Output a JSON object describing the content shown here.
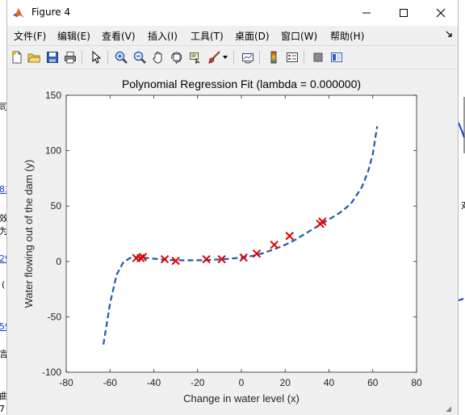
{
  "window": {
    "title": "Figure 4",
    "controls": {
      "minimize": "─",
      "maximize": "☐",
      "close": "✕"
    }
  },
  "menu": [
    {
      "label": "文件(F)"
    },
    {
      "label": "编辑(E)"
    },
    {
      "label": "查看(V)"
    },
    {
      "label": "插入(I)"
    },
    {
      "label": "工具(T)"
    },
    {
      "label": "桌面(D)"
    },
    {
      "label": "窗口(W)"
    },
    {
      "label": "帮助(H)"
    }
  ],
  "toolbar": [
    {
      "icon": "new-figure-icon"
    },
    {
      "icon": "open-file-icon"
    },
    {
      "icon": "save-icon"
    },
    {
      "icon": "print-icon"
    },
    {
      "icon": "pointer-icon"
    },
    {
      "icon": "zoom-in-icon"
    },
    {
      "icon": "zoom-out-icon"
    },
    {
      "icon": "pan-hand-icon"
    },
    {
      "icon": "rotate-3d-icon"
    },
    {
      "icon": "data-cursor-icon"
    },
    {
      "icon": "brush-icon"
    },
    {
      "icon": "link-plot-icon"
    },
    {
      "icon": "colorbar-icon"
    },
    {
      "icon": "legend-icon"
    },
    {
      "icon": "hide-plot-tools-icon"
    },
    {
      "icon": "show-plot-tools-icon"
    }
  ],
  "background_fragments": {
    "left": [
      "司",
      "83",
      "效",
      "为",
      "29",
      "(",
      "59",
      "言",
      "曲",
      "7"
    ],
    "right": [
      "对"
    ]
  },
  "chart_data": {
    "type": "line",
    "title": "Polynomial Regression Fit (lambda = 0.000000)",
    "xlabel": "Change in water level (x)",
    "ylabel": "Water flowing out of the dam (y)",
    "xlim": [
      -80,
      80
    ],
    "ylim": [
      -100,
      150
    ],
    "xticks": [
      -80,
      -60,
      -40,
      -20,
      0,
      20,
      40,
      60,
      80
    ],
    "yticks": [
      -100,
      -50,
      0,
      50,
      100,
      150
    ],
    "grid": false,
    "series": [
      {
        "style": "dashed",
        "color": "#1f5aa6",
        "x": [
          -63,
          -60,
          -57,
          -54,
          -51,
          -48,
          -45,
          -40,
          -35,
          -30,
          -25,
          -20,
          -15,
          -10,
          -5,
          0,
          5,
          10,
          15,
          20,
          25,
          30,
          35,
          40,
          45,
          50,
          55,
          58,
          60,
          62
        ],
        "y": [
          -75,
          -38,
          -12,
          -1,
          3,
          4,
          3.5,
          2.5,
          1.5,
          1,
          1,
          1,
          1.3,
          1.8,
          2.5,
          3.5,
          5,
          7.5,
          11,
          15,
          20,
          26,
          32,
          38,
          44,
          52,
          67,
          82,
          97,
          122
        ]
      },
      {
        "style": "markers",
        "marker": "x",
        "color": "#e00000",
        "x": [
          -48,
          -46,
          -45,
          -35,
          -30,
          -16,
          -9,
          1,
          7,
          15,
          22,
          36,
          37
        ],
        "y": [
          3,
          3,
          4,
          2,
          0.5,
          2,
          2,
          3.5,
          7,
          15,
          23,
          34,
          36
        ]
      }
    ]
  }
}
